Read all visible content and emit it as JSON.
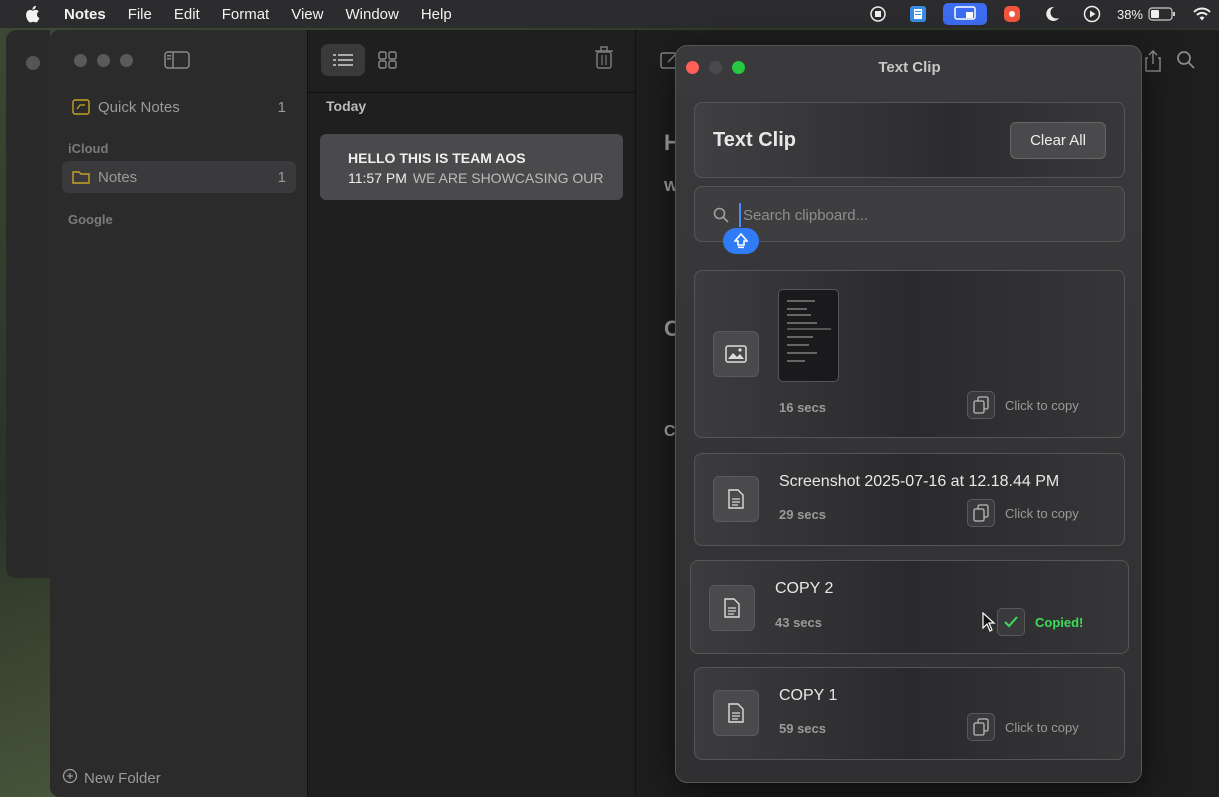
{
  "menubar": {
    "app_name": "Notes",
    "items": [
      "File",
      "Edit",
      "Format",
      "View",
      "Window",
      "Help"
    ],
    "battery": "38%"
  },
  "sidebar": {
    "quick_notes": {
      "label": "Quick Notes",
      "count": "1"
    },
    "section_icloud": "iCloud",
    "notes_folder": {
      "label": "Notes",
      "count": "1"
    },
    "section_google": "Google",
    "new_folder": "New Folder"
  },
  "note_list": {
    "group": "Today",
    "note": {
      "title": "HELLO THIS IS TEAM AOS",
      "time": "11:57 PM",
      "preview": "WE ARE SHOWCASING OUR"
    }
  },
  "editor": {
    "fragments": [
      "H",
      "W",
      "C",
      "C"
    ]
  },
  "textclip": {
    "window_title": "Text Clip",
    "header_title": "Text Clip",
    "clear_all": "Clear All",
    "search_placeholder": "Search clipboard...",
    "items": [
      {
        "type": "image",
        "name": "",
        "age": "16 secs",
        "action": "Click to copy"
      },
      {
        "type": "text",
        "name": "Screenshot 2025-07-16 at 12.18.44 PM",
        "age": "29 secs",
        "action": "Click to copy"
      },
      {
        "type": "text",
        "name": "COPY 2",
        "age": "43 secs",
        "action": "Copied!"
      },
      {
        "type": "text",
        "name": "COPY 1",
        "age": "59 secs",
        "action": "Click to copy"
      }
    ]
  },
  "colors": {
    "close": "#ff5f57",
    "minimize": "#4a4a4c",
    "zoom": "#28c840",
    "accent": "#2f7cf6",
    "copied": "#3ddc5a"
  }
}
